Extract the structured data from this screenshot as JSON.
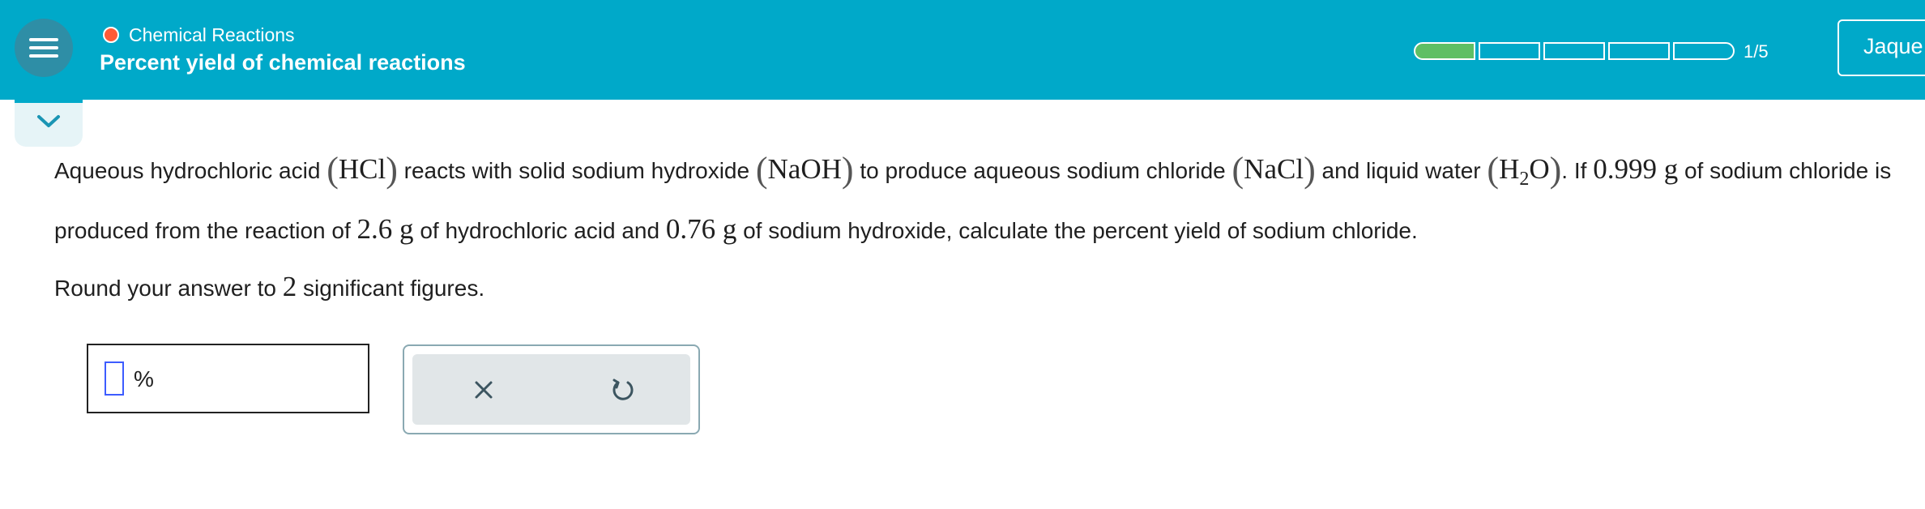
{
  "header": {
    "topic": "Chemical Reactions",
    "subtopic": "Percent yield of chemical reactions",
    "progress_text": "1/5",
    "progress": {
      "completed": 1,
      "total": 5
    },
    "user_name": "Jaque",
    "colors": {
      "bar": "#00a9c9",
      "topic_dot": "#ff5a36",
      "progress_fill": "#5fbf64"
    }
  },
  "question": {
    "t1": "Aqueous hydrochloric acid ",
    "f1": "HCl",
    "t2": " reacts with solid sodium hydroxide ",
    "f2": "NaOH",
    "t3": " to produce aqueous sodium chloride ",
    "f3": "NaCl",
    "t4": " and liquid water ",
    "f4_a": "H",
    "f4_sub": "2",
    "f4_b": "O",
    "t5": ". If ",
    "m1": "0.999 g",
    "t6": " of sodium chloride is produced from the reaction of ",
    "m2": "2.6 g",
    "t7": " of hydrochloric acid and ",
    "m3": "0.76 g",
    "t8": " of sodium hydroxide, calculate the percent yield of sodium chloride."
  },
  "round": {
    "pre": "Round your answer to ",
    "num": "2",
    "post": " significant figures."
  },
  "answer": {
    "value": "",
    "unit": "%"
  },
  "tools": {
    "clear_icon": "x-icon",
    "undo_icon": "undo-icon"
  }
}
